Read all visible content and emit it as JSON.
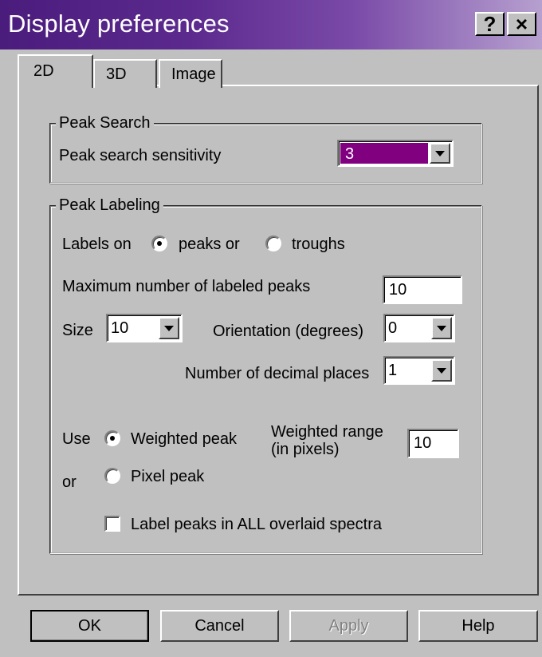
{
  "window": {
    "title": "Display preferences",
    "help_button": "?",
    "close_button": "×"
  },
  "tabs": [
    {
      "label": "2D",
      "active": true
    },
    {
      "label": "3D",
      "active": false
    },
    {
      "label": "Image",
      "active": false
    }
  ],
  "peak_search": {
    "group_label": "Peak Search",
    "sensitivity_label": "Peak search sensitivity",
    "sensitivity_value": "3",
    "sensitivity_color": "#800080"
  },
  "peak_labeling": {
    "group_label": "Peak Labeling",
    "labels_on_label": "Labels on",
    "peaks_option": "peaks or",
    "troughs_option": "troughs",
    "labels_on_selected": "peaks",
    "max_labeled_label": "Maximum number of labeled peaks",
    "max_labeled_value": "10",
    "size_label": "Size",
    "size_value": "10",
    "orientation_label": "Orientation (degrees)",
    "orientation_value": "0",
    "decimal_label": "Number of decimal places",
    "decimal_value": "1",
    "use_label": "Use",
    "weighted_option": "Weighted peak",
    "or_label": "or",
    "pixel_option": "Pixel peak",
    "peak_mode_selected": "weighted",
    "weighted_range_label_1": "Weighted range",
    "weighted_range_label_2": "(in pixels)",
    "weighted_range_value": "10",
    "overlaid_label": "Label peaks in ALL overlaid spectra",
    "overlaid_checked": false
  },
  "buttons": {
    "ok": "OK",
    "cancel": "Cancel",
    "apply": "Apply",
    "help": "Help"
  }
}
